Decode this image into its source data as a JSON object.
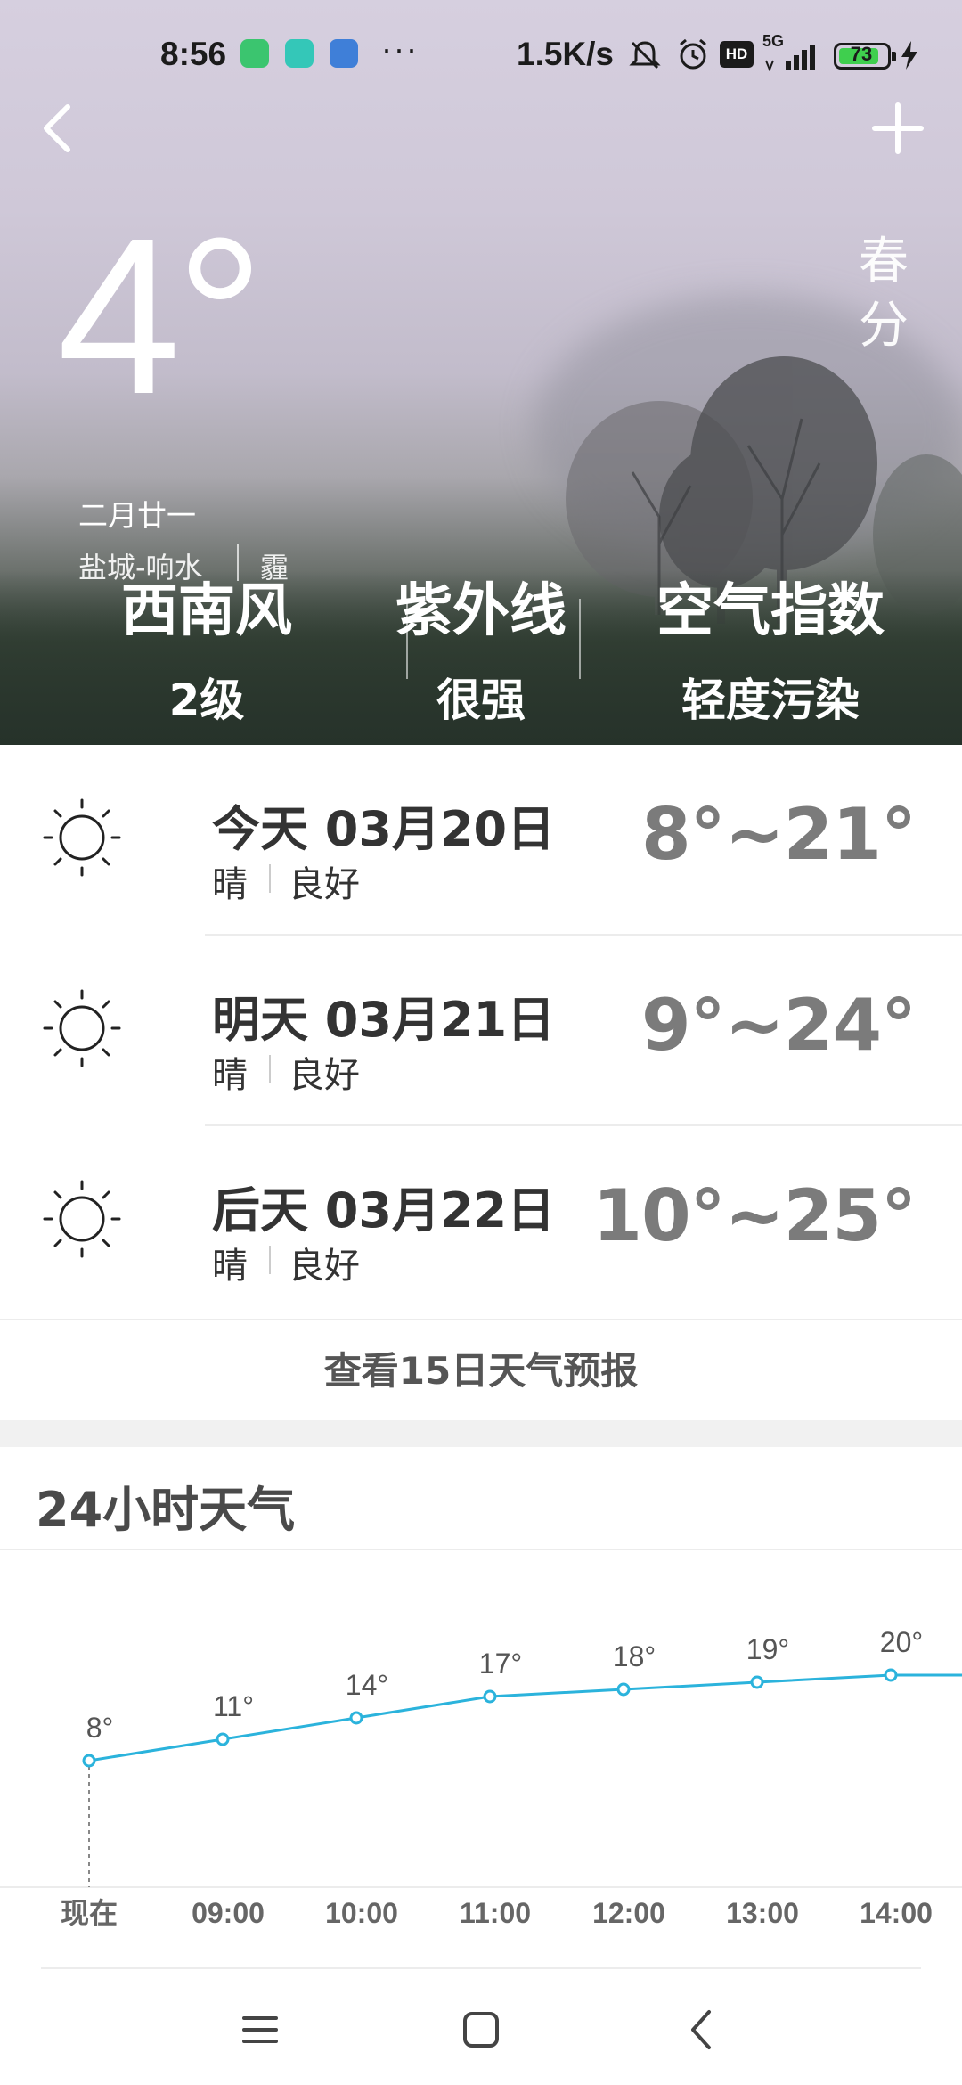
{
  "status_bar": {
    "time": "8:56",
    "more": "···",
    "net_speed": "1.5K/s",
    "hd_badge": "HD",
    "signal_label": "5G",
    "battery": "73"
  },
  "header": {
    "current_temp": "4°",
    "solar_term": "春\n分",
    "lunar_date": "二月廿一",
    "location": "盐城-响水",
    "condition": "霾"
  },
  "metrics": [
    {
      "label": "西南风",
      "value": "2级"
    },
    {
      "label": "紫外线",
      "value": "很强"
    },
    {
      "label": "空气指数",
      "value": "轻度污染"
    }
  ],
  "forecast": [
    {
      "date": "今天 03月20日",
      "weather": "晴",
      "air": "良好",
      "range": "8°~21°"
    },
    {
      "date": "明天 03月21日",
      "weather": "晴",
      "air": "良好",
      "range": "9°~24°"
    },
    {
      "date": "后天 03月22日",
      "weather": "晴",
      "air": "良好",
      "range": "10°~25°"
    }
  ],
  "more_forecast": "查看15日天气预报",
  "hourly_title": "24小时天气",
  "chart_data": {
    "type": "line",
    "title": "24小时天气",
    "x": [
      "现在",
      "09:00",
      "10:00",
      "11:00",
      "12:00",
      "13:00",
      "14:00"
    ],
    "series": [
      {
        "values": [
          8,
          11,
          14,
          17,
          18,
          19,
          20
        ],
        "labels": [
          "8°",
          "11°",
          "14°",
          "17°",
          "18°",
          "19°",
          "20°"
        ]
      }
    ],
    "color": "#2bb3dc"
  },
  "colors": {
    "accent": "#2bb3dc",
    "text": "#333333",
    "range": "#7b7b7b"
  }
}
